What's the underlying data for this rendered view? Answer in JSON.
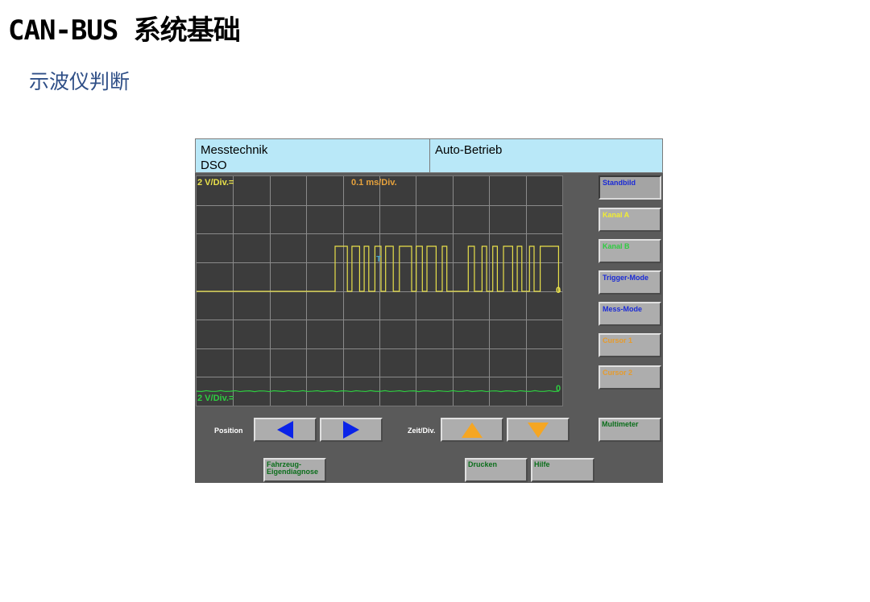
{
  "slide": {
    "title": "CAN-BUS 系统基础",
    "subtitle": "示波仪判断"
  },
  "header": {
    "mode_line1": "Messtechnik",
    "mode_line2": "DSO",
    "operation": "Auto-Betrieb"
  },
  "scope": {
    "channel_a_scale": "2 V/Div.=",
    "time_scale": "0.1 ms/Div.",
    "channel_b_scale": "2 V/Div.=",
    "trigger_marker": "T",
    "channel_a_zero": "0",
    "channel_b_zero": "0",
    "colors": {
      "channel_a": "#e8e04a",
      "channel_b": "#2ecc40",
      "time_scale": "#e6a23c",
      "grid": "#8a8a8a"
    }
  },
  "side_buttons": [
    {
      "label": "Standbild",
      "color": "#1a2ad6"
    },
    {
      "label": "Kanal A",
      "color": "#f2ee30"
    },
    {
      "label": "Kanal B",
      "color": "#2ecc40"
    },
    {
      "label": "Trigger-Mode",
      "color": "#1a2ad6"
    },
    {
      "label": "Mess-Mode",
      "color": "#1a2ad6"
    },
    {
      "label": "Cursor 1",
      "color": "#e69b2c"
    },
    {
      "label": "Cursor 2",
      "color": "#e69b2c"
    }
  ],
  "nav": {
    "position_label": "Position",
    "zeit_label": "Zeit/Div.",
    "left_icon": "arrow-left-icon",
    "right_icon": "arrow-right-icon",
    "up_icon": "arrow-up-icon",
    "down_icon": "arrow-down-icon"
  },
  "bottom_buttons": {
    "multimeter": "Multimeter",
    "fahrzeug": "Fahrzeug-\nEigendiagnose",
    "drucken": "Drucken",
    "hilfe": "Hilfe"
  }
}
